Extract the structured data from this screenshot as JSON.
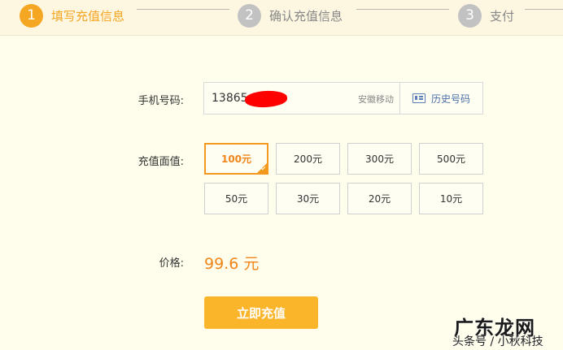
{
  "steps": [
    {
      "number": "1",
      "label": "填写充值信息",
      "state": "active"
    },
    {
      "number": "2",
      "label": "确认充值信息",
      "state": "inactive"
    },
    {
      "number": "3",
      "label": "支付",
      "state": "inactive"
    }
  ],
  "form": {
    "phone_label": "手机号码:",
    "phone_value": "13865",
    "carrier": "安徽移动",
    "history_label": "历史号码",
    "amount_label": "充值面值:",
    "amounts": [
      "100元",
      "200元",
      "300元",
      "500元",
      "50元",
      "30元",
      "20元",
      "10元"
    ],
    "selected_amount": "100元",
    "price_label": "价格:",
    "price_value": "99.6 元",
    "submit_label": "立即充值"
  },
  "watermark": {
    "main": "广东龙网",
    "sub": "头条号 / 小秋科技"
  },
  "colors": {
    "accent": "#f5a623",
    "price": "#f08519",
    "submit": "#fbb52a",
    "background": "#fffdeb",
    "mask": "#ff0000"
  }
}
